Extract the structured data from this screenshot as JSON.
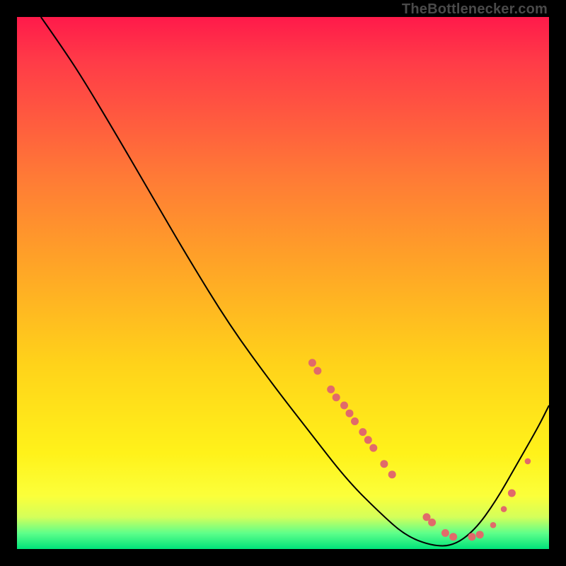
{
  "watermark": "TheBottlenecker.com",
  "chart_data": {
    "type": "line",
    "title": "",
    "xlabel": "",
    "ylabel": "",
    "xlim": [
      0,
      100
    ],
    "ylim": [
      0,
      100
    ],
    "curve": [
      {
        "x": 4.5,
        "y": 100
      },
      {
        "x": 8,
        "y": 95
      },
      {
        "x": 12,
        "y": 89
      },
      {
        "x": 18,
        "y": 79
      },
      {
        "x": 25,
        "y": 67
      },
      {
        "x": 32,
        "y": 55
      },
      {
        "x": 40,
        "y": 42
      },
      {
        "x": 48,
        "y": 31
      },
      {
        "x": 55,
        "y": 22
      },
      {
        "x": 62,
        "y": 13
      },
      {
        "x": 68,
        "y": 7
      },
      {
        "x": 73,
        "y": 2.5
      },
      {
        "x": 78,
        "y": 0.6
      },
      {
        "x": 82,
        "y": 0.6
      },
      {
        "x": 86,
        "y": 3.5
      },
      {
        "x": 90,
        "y": 9
      },
      {
        "x": 94,
        "y": 16
      },
      {
        "x": 98,
        "y": 23
      },
      {
        "x": 100,
        "y": 27
      }
    ],
    "markers": [
      {
        "x": 55.5,
        "y": 35,
        "r": 5.5
      },
      {
        "x": 56.5,
        "y": 33.5,
        "r": 5.5
      },
      {
        "x": 59,
        "y": 30,
        "r": 5.5
      },
      {
        "x": 60,
        "y": 28.5,
        "r": 5.5
      },
      {
        "x": 61.5,
        "y": 27,
        "r": 5.5
      },
      {
        "x": 62.5,
        "y": 25.5,
        "r": 5.5
      },
      {
        "x": 63.5,
        "y": 24,
        "r": 5.5
      },
      {
        "x": 65,
        "y": 22,
        "r": 5.5
      },
      {
        "x": 66,
        "y": 20.5,
        "r": 5.5
      },
      {
        "x": 67,
        "y": 19,
        "r": 5.5
      },
      {
        "x": 69,
        "y": 16,
        "r": 5.5
      },
      {
        "x": 70.5,
        "y": 14,
        "r": 5.5
      },
      {
        "x": 77,
        "y": 6,
        "r": 5.5
      },
      {
        "x": 78,
        "y": 5,
        "r": 5.5
      },
      {
        "x": 80.5,
        "y": 3,
        "r": 5.5
      },
      {
        "x": 82,
        "y": 2.3,
        "r": 5.5
      },
      {
        "x": 85.5,
        "y": 2.3,
        "r": 5.5
      },
      {
        "x": 87,
        "y": 2.7,
        "r": 5.5
      },
      {
        "x": 89.5,
        "y": 4.5,
        "r": 4.3
      },
      {
        "x": 91.5,
        "y": 7.5,
        "r": 4.3
      },
      {
        "x": 93,
        "y": 10.5,
        "r": 5.5
      },
      {
        "x": 96,
        "y": 16.5,
        "r": 4.3
      }
    ]
  }
}
